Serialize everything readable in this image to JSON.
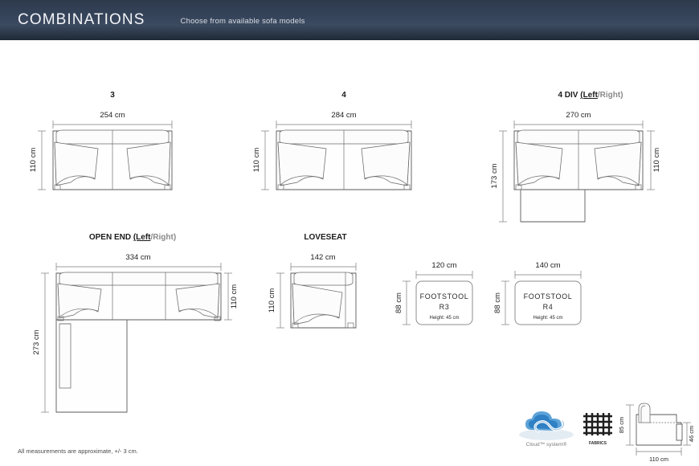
{
  "header": {
    "title": "COMBINATIONS",
    "subtitle": "Choose from available sofa models",
    "bar_color": "#35435a"
  },
  "footer": {
    "note": "All measurements are approximate, +/- 3 cm."
  },
  "models": [
    {
      "id": "model-3",
      "name": "3",
      "name_main": "3",
      "variant_left": "",
      "variant_right": "",
      "width_label": "254 cm",
      "depth_label": "110 cm",
      "width_cm": 254,
      "depth_cm": 110,
      "seats": 2,
      "type": "sofa"
    },
    {
      "id": "model-4",
      "name": "4",
      "name_main": "4",
      "variant_left": "",
      "variant_right": "",
      "width_label": "284 cm",
      "depth_label": "110 cm",
      "width_cm": 284,
      "depth_cm": 110,
      "seats": 2,
      "type": "sofa"
    },
    {
      "id": "model-4-div",
      "name": "4 DIV (Left/Right)",
      "name_main": "4 DIV",
      "variant_left": "(Left",
      "variant_right": "/Right)",
      "width_label": "270 cm",
      "depth_label": "110 cm",
      "total_depth_label": "173 cm",
      "width_cm": 270,
      "depth_cm": 110,
      "total_depth_cm": 173,
      "seats": 2,
      "type": "chaise"
    },
    {
      "id": "model-open-end",
      "name": "OPEN END (Left/Right)",
      "name_main": "OPEN END",
      "variant_left": "(Left",
      "variant_right": "/Right)",
      "width_label": "334 cm",
      "depth_label": "110 cm",
      "total_depth_label": "273 cm",
      "width_cm": 334,
      "depth_cm": 110,
      "total_depth_cm": 273,
      "seats": 3,
      "type": "corner"
    },
    {
      "id": "model-loveseat",
      "name": "LOVESEAT",
      "name_main": "LOVESEAT",
      "variant_left": "",
      "variant_right": "",
      "width_label": "142 cm",
      "depth_label": "110 cm",
      "width_cm": 142,
      "depth_cm": 110,
      "seats": 1,
      "type": "loveseat"
    }
  ],
  "footstools": [
    {
      "id": "footstool-r3",
      "label_line1": "FOOTSTOOL",
      "label_line2": "R3",
      "height_note": "Height: 45 cm",
      "width_label": "120 cm",
      "depth_label": "88 cm",
      "width_cm": 120,
      "depth_cm": 88,
      "height_cm": 45
    },
    {
      "id": "footstool-r4",
      "label_line1": "FOOTSTOOL",
      "label_line2": "R4",
      "height_note": "Height: 45 cm",
      "width_label": "140 cm",
      "depth_label": "88 cm",
      "width_cm": 140,
      "depth_cm": 88,
      "height_cm": 45
    }
  ],
  "badges": {
    "cloud_logo_text": "Cloud™ system®",
    "fabrics_label": "FABRICS",
    "cloud_color": "#2f80c4"
  },
  "side_view": {
    "height_label": "85 cm",
    "seat_height_label": "46 cm",
    "depth_label": "110 cm",
    "height_cm": 85,
    "seat_height_cm": 46,
    "depth_cm": 110
  }
}
